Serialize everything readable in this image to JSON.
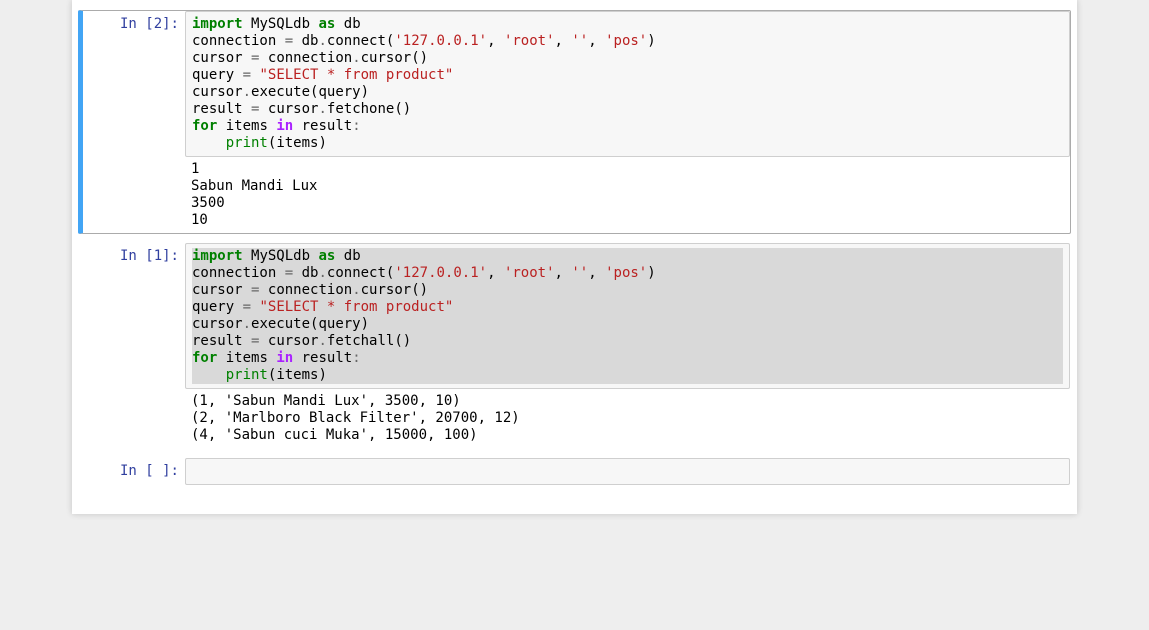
{
  "cells": [
    {
      "selected": true,
      "prompt": "In [2]:",
      "code": {
        "tokens": [
          {
            "t": "import",
            "c": "keyword"
          },
          {
            "t": " "
          },
          {
            "t": "MySQLdb",
            "c": "name"
          },
          {
            "t": " "
          },
          {
            "t": "as",
            "c": "keyword"
          },
          {
            "t": " "
          },
          {
            "t": "db",
            "c": "name"
          },
          {
            "t": "\n\n"
          },
          {
            "t": "connection",
            "c": "name"
          },
          {
            "t": " "
          },
          {
            "t": "=",
            "c": "op"
          },
          {
            "t": " "
          },
          {
            "t": "db",
            "c": "name"
          },
          {
            "t": ".",
            "c": "op"
          },
          {
            "t": "connect",
            "c": "name"
          },
          {
            "t": "(",
            "c": "paren"
          },
          {
            "t": "'127.0.0.1'",
            "c": "string"
          },
          {
            "t": ", "
          },
          {
            "t": "'root'",
            "c": "string"
          },
          {
            "t": ", "
          },
          {
            "t": "''",
            "c": "string"
          },
          {
            "t": ", "
          },
          {
            "t": "'pos'",
            "c": "string"
          },
          {
            "t": ")",
            "c": "paren"
          },
          {
            "t": "\n\n"
          },
          {
            "t": "cursor",
            "c": "name"
          },
          {
            "t": " "
          },
          {
            "t": "=",
            "c": "op"
          },
          {
            "t": " "
          },
          {
            "t": "connection",
            "c": "name"
          },
          {
            "t": ".",
            "c": "op"
          },
          {
            "t": "cursor",
            "c": "name"
          },
          {
            "t": "()",
            "c": "paren"
          },
          {
            "t": "\n\n"
          },
          {
            "t": "query",
            "c": "name"
          },
          {
            "t": " "
          },
          {
            "t": "=",
            "c": "op"
          },
          {
            "t": " "
          },
          {
            "t": "\"SELECT * from product\"",
            "c": "string"
          },
          {
            "t": "\n\n"
          },
          {
            "t": "cursor",
            "c": "name"
          },
          {
            "t": ".",
            "c": "op"
          },
          {
            "t": "execute",
            "c": "name"
          },
          {
            "t": "(",
            "c": "paren"
          },
          {
            "t": "query",
            "c": "name"
          },
          {
            "t": ")",
            "c": "paren"
          },
          {
            "t": "\n"
          },
          {
            "t": "result",
            "c": "name"
          },
          {
            "t": " "
          },
          {
            "t": "=",
            "c": "op"
          },
          {
            "t": " "
          },
          {
            "t": "cursor",
            "c": "name"
          },
          {
            "t": ".",
            "c": "op"
          },
          {
            "t": "fetchone",
            "c": "name"
          },
          {
            "t": "()",
            "c": "paren"
          },
          {
            "t": "\n"
          },
          {
            "t": "for",
            "c": "keyword"
          },
          {
            "t": " "
          },
          {
            "t": "items",
            "c": "name"
          },
          {
            "t": " "
          },
          {
            "t": "in",
            "c": "kwop"
          },
          {
            "t": " "
          },
          {
            "t": "result",
            "c": "name"
          },
          {
            "t": ":",
            "c": "op"
          },
          {
            "t": "\n    "
          },
          {
            "t": "print",
            "c": "builtin"
          },
          {
            "t": "(",
            "c": "paren"
          },
          {
            "t": "items",
            "c": "name"
          },
          {
            "t": ")",
            "c": "paren"
          }
        ],
        "highlightLines": []
      },
      "output": "1\nSabun Mandi Lux\n3500\n10"
    },
    {
      "selected": false,
      "prompt": "In [1]:",
      "code": {
        "tokens": [
          {
            "t": "import",
            "c": "keyword"
          },
          {
            "t": " "
          },
          {
            "t": "MySQLdb",
            "c": "name"
          },
          {
            "t": " "
          },
          {
            "t": "as",
            "c": "keyword"
          },
          {
            "t": " "
          },
          {
            "t": "db",
            "c": "name"
          },
          {
            "t": "\n\n"
          },
          {
            "t": "connection",
            "c": "name"
          },
          {
            "t": " "
          },
          {
            "t": "=",
            "c": "op"
          },
          {
            "t": " "
          },
          {
            "t": "db",
            "c": "name"
          },
          {
            "t": ".",
            "c": "op"
          },
          {
            "t": "connect",
            "c": "name"
          },
          {
            "t": "(",
            "c": "paren"
          },
          {
            "t": "'127.0.0.1'",
            "c": "string"
          },
          {
            "t": ", "
          },
          {
            "t": "'root'",
            "c": "string"
          },
          {
            "t": ", "
          },
          {
            "t": "''",
            "c": "string"
          },
          {
            "t": ", "
          },
          {
            "t": "'pos'",
            "c": "string"
          },
          {
            "t": ")",
            "c": "paren"
          },
          {
            "t": "\n\n"
          },
          {
            "t": "cursor",
            "c": "name"
          },
          {
            "t": " "
          },
          {
            "t": "=",
            "c": "op"
          },
          {
            "t": " "
          },
          {
            "t": "connection",
            "c": "name"
          },
          {
            "t": ".",
            "c": "op"
          },
          {
            "t": "cursor",
            "c": "name"
          },
          {
            "t": "()",
            "c": "paren"
          },
          {
            "t": "\n\n"
          },
          {
            "t": "query",
            "c": "name"
          },
          {
            "t": " "
          },
          {
            "t": "=",
            "c": "op"
          },
          {
            "t": " "
          },
          {
            "t": "\"SELECT * from product\"",
            "c": "string"
          },
          {
            "t": "\n\n"
          },
          {
            "t": "cursor",
            "c": "name"
          },
          {
            "t": ".",
            "c": "op"
          },
          {
            "t": "execute",
            "c": "name"
          },
          {
            "t": "(",
            "c": "paren"
          },
          {
            "t": "query",
            "c": "name"
          },
          {
            "t": ")",
            "c": "paren"
          },
          {
            "t": "\n"
          },
          {
            "t": "result",
            "c": "name"
          },
          {
            "t": " "
          },
          {
            "t": "=",
            "c": "op"
          },
          {
            "t": " "
          },
          {
            "t": "cursor",
            "c": "name"
          },
          {
            "t": ".",
            "c": "op"
          },
          {
            "t": "fetchall",
            "c": "name"
          },
          {
            "t": "()",
            "c": "paren"
          },
          {
            "t": "\n"
          },
          {
            "t": "for",
            "c": "keyword"
          },
          {
            "t": " "
          },
          {
            "t": "items",
            "c": "name"
          },
          {
            "t": " "
          },
          {
            "t": "in",
            "c": "kwop"
          },
          {
            "t": " "
          },
          {
            "t": "result",
            "c": "name"
          },
          {
            "t": ":",
            "c": "op"
          },
          {
            "t": "\n    "
          },
          {
            "t": "print",
            "c": "builtin"
          },
          {
            "t": "(",
            "c": "paren"
          },
          {
            "t": "items",
            "c": "name"
          },
          {
            "t": ")",
            "c": "paren"
          }
        ],
        "highlightLines": [
          0,
          1,
          2,
          3,
          4,
          5,
          6,
          7,
          8,
          9,
          10,
          11
        ]
      },
      "output": "(1, 'Sabun Mandi Lux', 3500, 10)\n(2, 'Marlboro Black Filter', 20700, 12)\n(4, 'Sabun cuci Muka', 15000, 100)"
    },
    {
      "selected": false,
      "prompt": "In [ ]:",
      "code": {
        "tokens": [],
        "highlightLines": []
      },
      "output": null,
      "empty": true
    }
  ]
}
